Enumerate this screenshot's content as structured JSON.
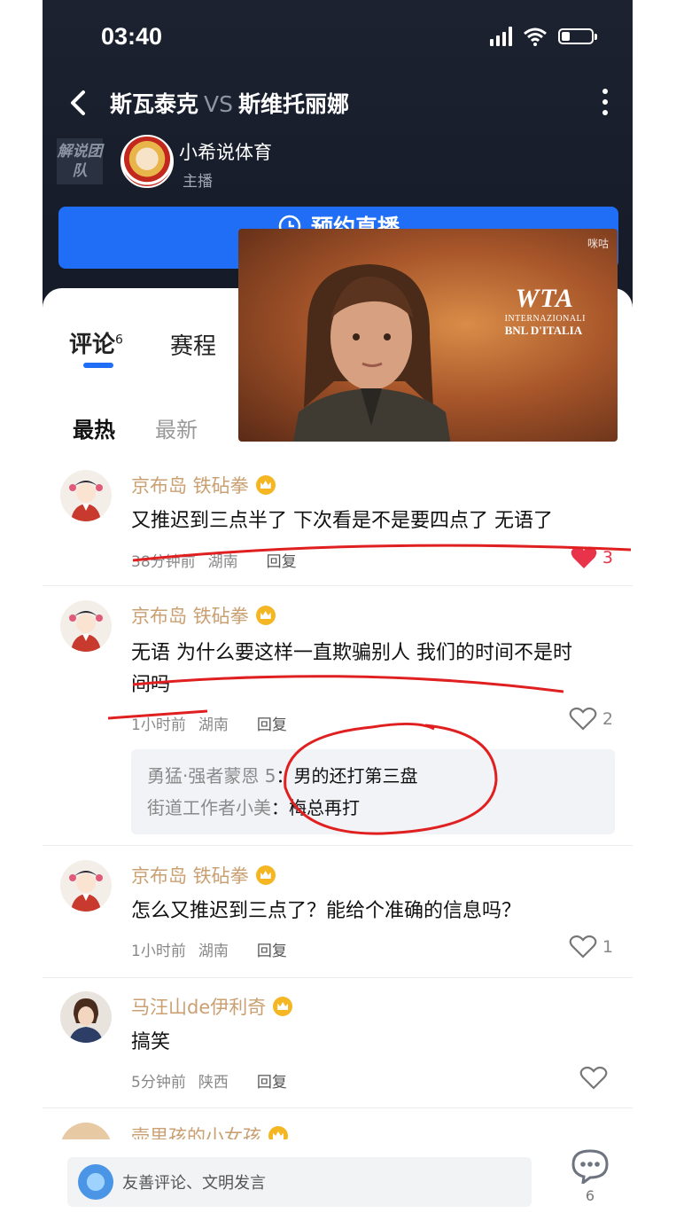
{
  "status": {
    "time": "03:40"
  },
  "header": {
    "home_team": "斯瓦泰克",
    "vs": "VS",
    "away_team": "斯维托丽娜",
    "team_label": "解说团队",
    "anchor_name": "小希说体育",
    "anchor_role": "主播",
    "reserve_label": "预约直播"
  },
  "video": {
    "brand": "咪咕",
    "wta_title": "WTA",
    "event_line1": "INTERNAZIONALI",
    "event_line2": "BNL D'ITALIA"
  },
  "tabs": {
    "comments_label": "评论",
    "comments_count": "6",
    "schedule_label": "赛程"
  },
  "sort": {
    "hot": "最热",
    "new": "最新"
  },
  "comments": [
    {
      "user": "京布岛 铁砧拳",
      "text": "又推迟到三点半了 下次看是不是要四点了 无语了",
      "time": "38分钟前",
      "region": "湖南",
      "reply_label": "回复",
      "likes": "3"
    },
    {
      "user": "京布岛 铁砧拳",
      "text_line1": "无语 为什么要这样一直欺骗别人 我们的时间不是时",
      "text_line2": "间吗",
      "time": "1小时前",
      "region": "湖南",
      "reply_label": "回复",
      "likes": "2",
      "replies": [
        {
          "user": "勇猛·强者蒙恩 5",
          "text": "：男的还打第三盘"
        },
        {
          "user": "街道工作者小美",
          "text": "：梅总再打"
        }
      ]
    },
    {
      "user": "京布岛 铁砧拳",
      "text": "怎么又推迟到三点了？能给个准确的信息吗？",
      "time": "1小时前",
      "region": "湖南",
      "reply_label": "回复",
      "likes": "1"
    },
    {
      "user": "马汪山de伊利奇",
      "text": "搞笑",
      "time": "5分钟前",
      "region": "陕西",
      "reply_label": "回复",
      "likes": ""
    },
    {
      "user": "壶里孩的小女孩"
    }
  ],
  "bottom": {
    "placeholder": "友善评论、文明发言",
    "chat_count": "6"
  },
  "colors": {
    "accent": "#1f6ef5",
    "username": "#caa072",
    "liked": "#e8334a",
    "annotation": "#e02020"
  }
}
